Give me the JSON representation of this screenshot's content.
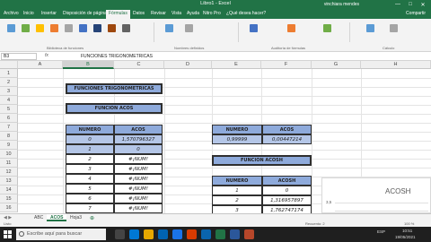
{
  "window": {
    "title": "Libro1 - Excel",
    "user": "vinchiara mendes",
    "min": "—",
    "max": "□",
    "close": "✕"
  },
  "menu": {
    "tabs": [
      "Archivo",
      "Inicio",
      "Insertar",
      "Disposición de página",
      "Fórmulas",
      "Datos",
      "Revisar",
      "Vista",
      "Ayuda",
      "Nitro Pro",
      "¿Qué desea hacer?"
    ],
    "active_index": 4,
    "share": "Compartir"
  },
  "ribbon": {
    "groups": [
      "Biblioteca de funciones",
      "Nombres definidos",
      "Auditoría de fórmulas",
      "Cálculo"
    ]
  },
  "formula_bar": {
    "name_box": "B3",
    "fx": "fx",
    "formula": "FUNCIONES TRIGONOMETRICAS"
  },
  "columns": [
    "A",
    "B",
    "C",
    "D",
    "E",
    "F",
    "G",
    "H"
  ],
  "selected_column": "B",
  "rows": [
    "1",
    "2",
    "3",
    "4",
    "5",
    "6",
    "7",
    "8",
    "9",
    "10",
    "11",
    "12",
    "13",
    "14",
    "15",
    "16",
    "17"
  ],
  "sheet": {
    "title1": "FUNCIONES TRIGONOMETRICAS",
    "title2": "FUNCION ACOS",
    "acos_table": {
      "headers": [
        "NUMERO",
        "ACOS"
      ],
      "rows": [
        [
          "0",
          "1,570796327"
        ],
        [
          "1",
          "0"
        ],
        [
          "2",
          "#¡NUM!"
        ],
        [
          "3",
          "#¡NUM!"
        ],
        [
          "4",
          "#¡NUM!"
        ],
        [
          "5",
          "#¡NUM!"
        ],
        [
          "6",
          "#¡NUM!"
        ],
        [
          "7",
          "#¡NUM!"
        ]
      ]
    },
    "acos_small": {
      "headers": [
        "NUMERO",
        "ACOS"
      ],
      "row": [
        "0,99999",
        "0,00447214"
      ]
    },
    "acosh_title": "FUNCION ACOSH",
    "acosh_table": {
      "headers": [
        "NUMERO",
        "ACOSH"
      ],
      "rows": [
        [
          "1",
          "0"
        ],
        [
          "2",
          "1,316957897"
        ],
        [
          "3",
          "1,762747174"
        ]
      ]
    },
    "chart": {
      "title": "ACOSH",
      "ytick": "3,5"
    }
  },
  "sheet_tabs": {
    "nav": "◀ ▶",
    "tabs": [
      "ABC",
      "ACOS",
      "Hoja3"
    ],
    "active_index": 1,
    "add": "⊕"
  },
  "status": {
    "left": "Listo",
    "right": "Recuento: 2",
    "zoom": "100 %"
  },
  "taskbar": {
    "search_placeholder": "Escribe aquí para buscar",
    "time": "10:51",
    "date": "19/05/2021",
    "lang": "ESP"
  },
  "colors": {
    "excel_green": "#217346",
    "header_blue": "#8eaadb",
    "light_blue": "#b4c6e7"
  }
}
